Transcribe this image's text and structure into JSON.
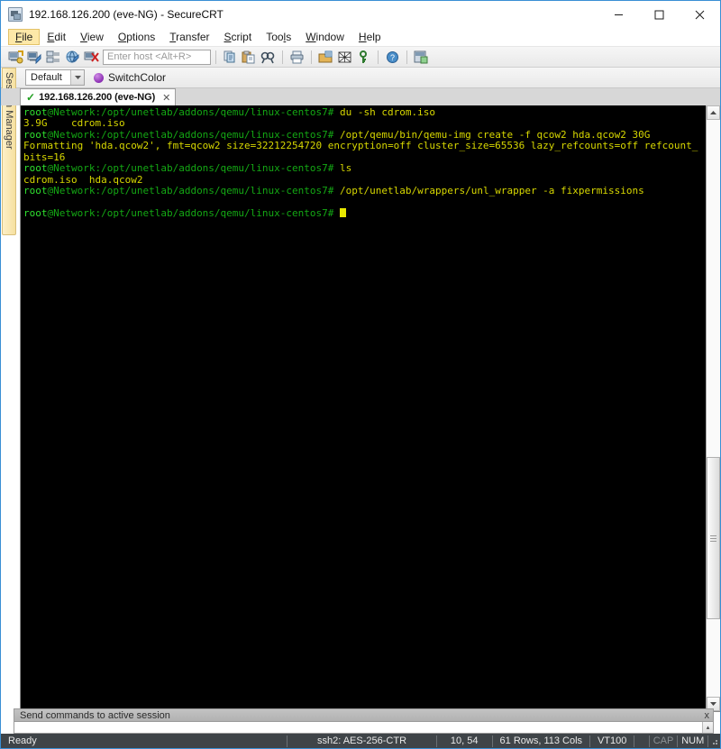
{
  "window": {
    "title": "192.168.126.200 (eve-NG) - SecureCRT",
    "icon": "securecrt-app-icon",
    "minimize": "minimize-icon",
    "maximize": "maximize-icon",
    "close": "close-icon"
  },
  "menu": {
    "items": [
      {
        "label": "File",
        "accel": "F",
        "active": true
      },
      {
        "label": "Edit",
        "accel": "E",
        "active": false
      },
      {
        "label": "View",
        "accel": "V",
        "active": false
      },
      {
        "label": "Options",
        "accel": "O",
        "active": false
      },
      {
        "label": "Transfer",
        "accel": "T",
        "active": false
      },
      {
        "label": "Script",
        "accel": "S",
        "active": false
      },
      {
        "label": "Tools",
        "accel": "l",
        "active": false
      },
      {
        "label": "Window",
        "accel": "W",
        "active": false
      },
      {
        "label": "Help",
        "accel": "H",
        "active": false
      }
    ]
  },
  "toolbar": {
    "host_placeholder": "Enter host <Alt+R>",
    "icons": [
      "new-session-icon",
      "connect-session-icon",
      "session-manager-icon",
      "connect-sftp-icon",
      "disconnect-icon",
      "copy-icon",
      "paste-icon",
      "find-icon",
      "print-icon",
      "session-options-icon",
      "clear-screen-icon",
      "key-icon",
      "help-icon",
      "session-window-icon"
    ]
  },
  "toolbar2": {
    "profile_value": "Default",
    "profile_caret": "chevron-down-icon",
    "switch_color_label": "SwitchColor",
    "switch_color_dot": "purple-circle-icon"
  },
  "sidebar": {
    "session_manager_label": "Session Manager"
  },
  "tabs": [
    {
      "label": "192.168.126.200 (eve-NG)",
      "status_icon": "connected-check-icon",
      "close_icon": "tab-close-icon",
      "active": true
    }
  ],
  "terminal": {
    "prompt_user": "root",
    "prompt_host_path": "@Network:/opt/unetlab/addons/qemu/linux-centos7# ",
    "lines": [
      {
        "type": "prompt",
        "command": "du -sh cdrom.iso"
      },
      {
        "type": "output",
        "text": "3.9G\tcdrom.iso"
      },
      {
        "type": "prompt",
        "command": "/opt/qemu/bin/qemu-img create -f qcow2 hda.qcow2 30G"
      },
      {
        "type": "output",
        "text": "Formatting 'hda.qcow2', fmt=qcow2 size=32212254720 encryption=off cluster_size=65536 lazy_refcounts=off refcount_"
      },
      {
        "type": "output",
        "text": "bits=16"
      },
      {
        "type": "prompt",
        "command": "ls"
      },
      {
        "type": "output",
        "text": "cdrom.iso  hda.qcow2"
      },
      {
        "type": "prompt",
        "command": "/opt/unetlab/wrappers/unl_wrapper -a fixpermissions"
      },
      {
        "type": "output",
        "text": ""
      },
      {
        "type": "prompt",
        "command": "",
        "cursor": true
      }
    ],
    "colors": {
      "background": "#000000",
      "user": "#2fe02f",
      "path": "#14a814",
      "command": "#d7d700",
      "cursor": "#e8e800"
    },
    "scrollbar": {
      "up_arrow": "scroll-up-icon",
      "down_arrow": "scroll-down-icon"
    }
  },
  "send_panel": {
    "title": "Send commands to active session",
    "close_label": "x",
    "input_value": "",
    "spinner_icon": "spinner-arrows-icon"
  },
  "statusbar": {
    "ready": "Ready",
    "cipher": "ssh2: AES-256-CTR",
    "cursor_pos": "10,  54",
    "dimensions": "61 Rows, 113 Cols",
    "emulation": "VT100",
    "cap": "CAP",
    "num": "NUM"
  }
}
